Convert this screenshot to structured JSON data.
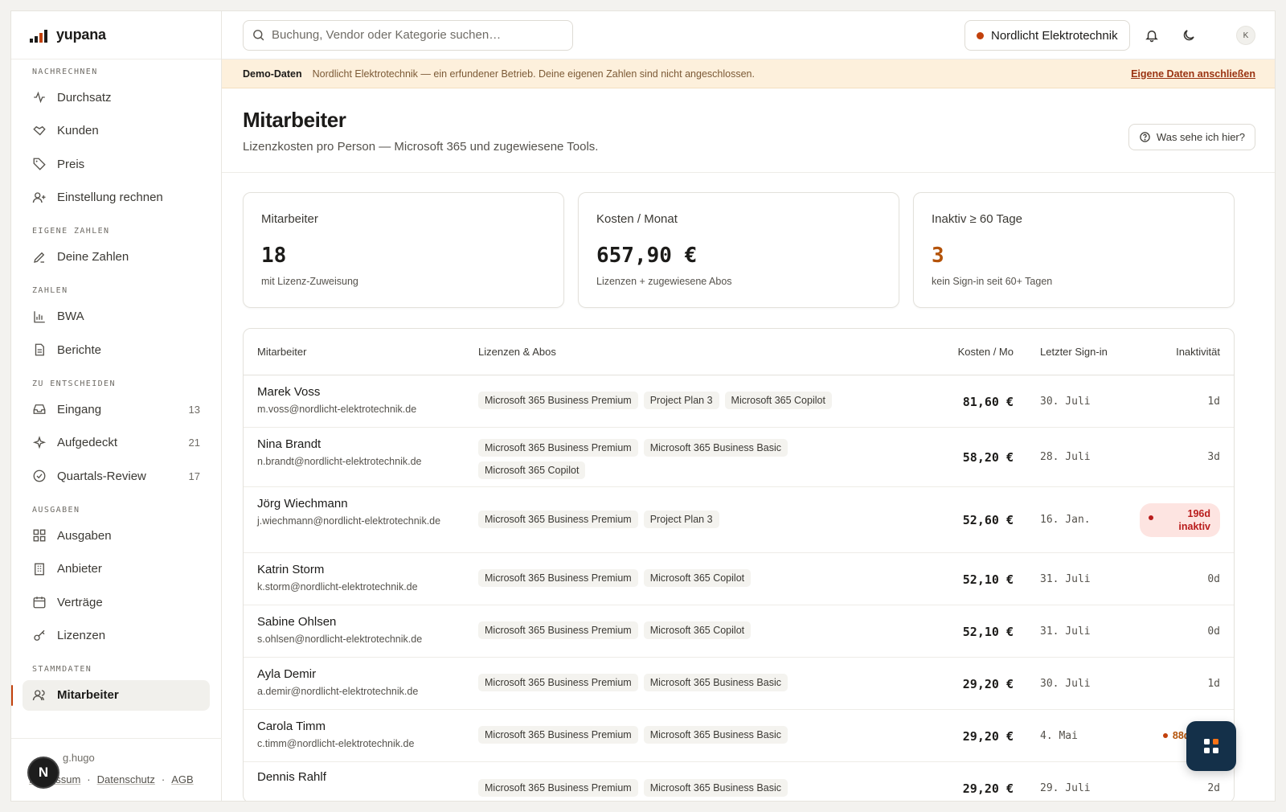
{
  "brand": {
    "name": "yupana",
    "accent": "#c2410c"
  },
  "sidebar": {
    "sections": [
      {
        "label": "NACHRECHNEN",
        "items": [
          {
            "label": "Durchsatz",
            "icon": "activity-icon"
          },
          {
            "label": "Kunden",
            "icon": "handshake-icon"
          },
          {
            "label": "Preis",
            "icon": "tag-icon"
          },
          {
            "label": "Einstellung rechnen",
            "icon": "user-plus-icon"
          }
        ]
      },
      {
        "label": "EIGENE ZAHLEN",
        "items": [
          {
            "label": "Deine Zahlen",
            "icon": "pencil-icon"
          }
        ]
      },
      {
        "label": "ZAHLEN",
        "items": [
          {
            "label": "BWA",
            "icon": "bar-chart-icon"
          },
          {
            "label": "Berichte",
            "icon": "document-icon"
          }
        ]
      },
      {
        "label": "ZU ENTSCHEIDEN",
        "items": [
          {
            "label": "Eingang",
            "icon": "inbox-icon",
            "count": "13"
          },
          {
            "label": "Aufgedeckt",
            "icon": "sparkle-icon",
            "count": "21"
          },
          {
            "label": "Quartals-Review",
            "icon": "check-circle-icon",
            "count": "17"
          }
        ]
      },
      {
        "label": "AUSGABEN",
        "items": [
          {
            "label": "Ausgaben",
            "icon": "grid-icon"
          },
          {
            "label": "Anbieter",
            "icon": "building-icon"
          },
          {
            "label": "Verträge",
            "icon": "calendar-icon"
          },
          {
            "label": "Lizenzen",
            "icon": "key-icon"
          }
        ]
      },
      {
        "label": "STAMMDATEN",
        "items": [
          {
            "label": "Mitarbeiter",
            "icon": "users-icon",
            "active": true
          }
        ]
      }
    ],
    "footer": {
      "user": "g.hugo",
      "links": [
        "Impressum",
        "Datenschutz",
        "AGB"
      ],
      "badge": "N"
    }
  },
  "topbar": {
    "search_placeholder": "Buchung, Vendor oder Kategorie suchen…",
    "company": "Nordlicht Elektrotechnik",
    "avatar": "K"
  },
  "banner": {
    "tag": "Demo-Daten",
    "message": "Nordlicht Elektrotechnik — ein erfundener Betrieb. Deine eigenen Zahlen sind nicht angeschlossen.",
    "link": "Eigene Daten anschließen"
  },
  "page": {
    "title": "Mitarbeiter",
    "subtitle": "Lizenzkosten pro Person — Microsoft 365 und zugewiesene Tools.",
    "help": "Was sehe ich hier?"
  },
  "cards": [
    {
      "label": "Mitarbeiter",
      "value": "18",
      "note": "mit Lizenz-Zuweisung"
    },
    {
      "label": "Kosten / Monat",
      "value": "657,90 €",
      "note": "Lizenzen + zugewiesene Abos"
    },
    {
      "label": "Inaktiv ≥ 60 Tage",
      "value": "3",
      "note": "kein Sign-in seit 60+ Tagen"
    }
  ],
  "table": {
    "headers": {
      "name": "Mitarbeiter",
      "licenses": "Lizenzen & Abos",
      "cost": "Kosten / Mo",
      "signin": "Letzter Sign-in",
      "inactivity": "Inaktivität"
    },
    "rows": [
      {
        "name": "Marek Voss",
        "email": "m.voss@nordlicht-elektrotechnik.de",
        "licenses": [
          "Microsoft 365 Business Premium",
          "Project Plan 3",
          "Microsoft 365 Copilot"
        ],
        "cost": "81,60 €",
        "signin": "30. Juli",
        "inactivity": "1d"
      },
      {
        "name": "Nina Brandt",
        "email": "n.brandt@nordlicht-elektrotechnik.de",
        "licenses": [
          "Microsoft 365 Business Premium",
          "Microsoft 365 Business Basic",
          "Microsoft 365 Copilot"
        ],
        "cost": "58,20 €",
        "signin": "28. Juli",
        "inactivity": "3d"
      },
      {
        "name": "Jörg Wiechmann",
        "email": "j.wiechmann@nordlicht-elektrotechnik.de",
        "licenses": [
          "Microsoft 365 Business Premium",
          "Project Plan 3"
        ],
        "cost": "52,60 €",
        "signin": "16. Jan.",
        "inactivity": "196d inaktiv",
        "inactivity_state": "alert"
      },
      {
        "name": "Katrin Storm",
        "email": "k.storm@nordlicht-elektrotechnik.de",
        "licenses": [
          "Microsoft 365 Business Premium",
          "Microsoft 365 Copilot"
        ],
        "cost": "52,10 €",
        "signin": "31. Juli",
        "inactivity": "0d"
      },
      {
        "name": "Sabine Ohlsen",
        "email": "s.ohlsen@nordlicht-elektrotechnik.de",
        "licenses": [
          "Microsoft 365 Business Premium",
          "Microsoft 365 Copilot"
        ],
        "cost": "52,10 €",
        "signin": "31. Juli",
        "inactivity": "0d"
      },
      {
        "name": "Ayla Demir",
        "email": "a.demir@nordlicht-elektrotechnik.de",
        "licenses": [
          "Microsoft 365 Business Premium",
          "Microsoft 365 Business Basic"
        ],
        "cost": "29,20 €",
        "signin": "30. Juli",
        "inactivity": "1d"
      },
      {
        "name": "Carola Timm",
        "email": "c.timm@nordlicht-elektrotechnik.de",
        "licenses": [
          "Microsoft 365 Business Premium",
          "Microsoft 365 Business Basic"
        ],
        "cost": "29,20 €",
        "signin": "4. Mai",
        "inactivity": "88d in",
        "inactivity_state": "warn"
      },
      {
        "name": "Dennis Rahlf",
        "email": "",
        "licenses": [
          "Microsoft 365 Business Premium",
          "Microsoft 365 Business Basic"
        ],
        "cost": "29,20 €",
        "signin": "29. Juli",
        "inactivity": "2d"
      }
    ]
  }
}
